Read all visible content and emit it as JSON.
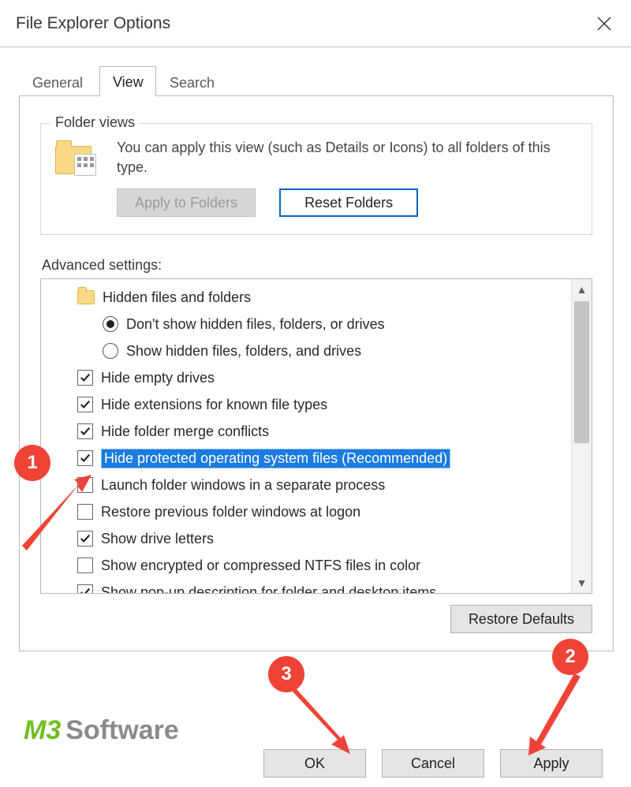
{
  "titlebar": {
    "title": "File Explorer Options"
  },
  "tabs": {
    "general": "General",
    "view": "View",
    "search": "Search",
    "active": "View"
  },
  "folderViews": {
    "legend": "Folder views",
    "description": "You can apply this view (such as Details or Icons) to all folders of this type.",
    "applyBtn": "Apply to Folders",
    "resetBtn": "Reset Folders"
  },
  "advanced": {
    "label": "Advanced settings:",
    "items": [
      {
        "kind": "header",
        "text": "Hidden files and folders"
      },
      {
        "kind": "radio",
        "text": "Don't show hidden files, folders, or drives",
        "checked": true
      },
      {
        "kind": "radio",
        "text": "Show hidden files, folders, and drives",
        "checked": false
      },
      {
        "kind": "check",
        "text": "Hide empty drives",
        "checked": true
      },
      {
        "kind": "check",
        "text": "Hide extensions for known file types",
        "checked": true
      },
      {
        "kind": "check",
        "text": "Hide folder merge conflicts",
        "checked": true
      },
      {
        "kind": "check",
        "text": "Hide protected operating system files (Recommended)",
        "checked": true,
        "selected": true
      },
      {
        "kind": "check",
        "text": "Launch folder windows in a separate process",
        "checked": false
      },
      {
        "kind": "check",
        "text": "Restore previous folder windows at logon",
        "checked": false
      },
      {
        "kind": "check",
        "text": "Show drive letters",
        "checked": true
      },
      {
        "kind": "check",
        "text": "Show encrypted or compressed NTFS files in color",
        "checked": false
      },
      {
        "kind": "check",
        "text": "Show pop-up description for folder and desktop items",
        "checked": true
      }
    ],
    "restoreDefaults": "Restore Defaults"
  },
  "dialogButtons": {
    "ok": "OK",
    "cancel": "Cancel",
    "apply": "Apply"
  },
  "annotations": {
    "c1": "1",
    "c2": "2",
    "c3": "3"
  },
  "watermark": {
    "m3": "M3",
    "soft": "Software"
  }
}
